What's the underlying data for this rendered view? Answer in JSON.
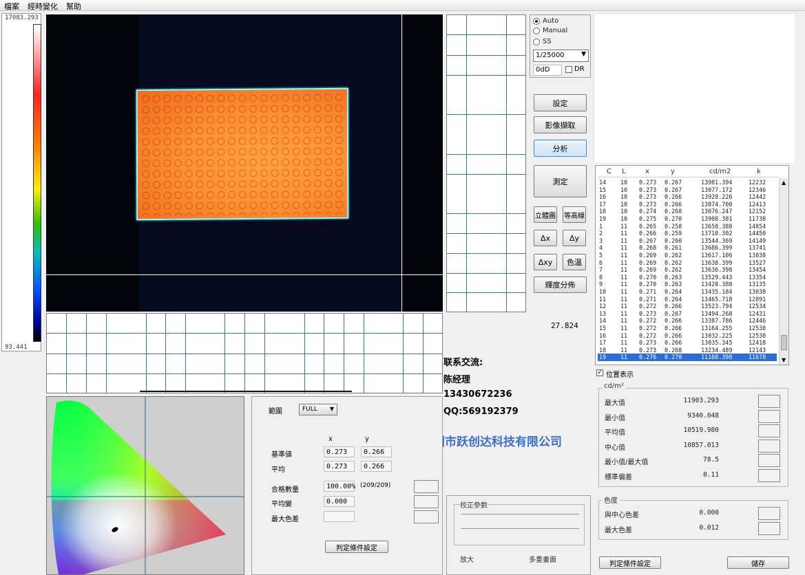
{
  "menu": [
    "檔案",
    "經時變化",
    "幫助"
  ],
  "scale": {
    "max": "17083.293",
    "min": "93.441"
  },
  "camera": {
    "modes": [
      "Auto",
      "Manual",
      "SS"
    ],
    "selected_mode": "Auto",
    "shutter": "1/25000",
    "nd": "0dD",
    "dr_label": "DR"
  },
  "buttons": {
    "settings": "設定",
    "capture": "影像擷取",
    "analyze": "分析",
    "measure": "測定",
    "view3d": "立體圖",
    "contour": "等高線",
    "dx": "Δx",
    "dy": "Δy",
    "dxy": "Δxy",
    "color_temp": "色温",
    "brightness_dist": "輝度分佈",
    "judge_settings": "判定條件設定",
    "judge_settings2": "判定條件設定",
    "save": "儲存"
  },
  "readout": "27.824",
  "contact": {
    "title": "联系交流:",
    "name": "陈经理",
    "phone": "13430672236",
    "qq": "QQ:569192379",
    "company": "深圳市跃创达科技有限公司"
  },
  "range_panel": {
    "range_label": "範圍",
    "range_value": "FULL",
    "col_x": "x",
    "col_y": "y",
    "ref_label": "基準値",
    "ref_x": "0.273",
    "ref_y": "0.266",
    "avg_label": "平均",
    "avg_x": "0.273",
    "avg_y": "0.266",
    "pass_label": "合格數量",
    "pass_value": "100.00%",
    "pass_count": "(209/209)",
    "avg_change_label": "平均變",
    "avg_change_value": "0.000",
    "max_diff_label": "最大色差"
  },
  "calib": {
    "title": "校正參數",
    "zoom": "放大",
    "multi": "多重畫面"
  },
  "table": {
    "headers": [
      "C",
      "L",
      "x",
      "y",
      "cd/m2",
      "k"
    ],
    "rows": [
      [
        "14",
        "10",
        "0.273",
        "0.267",
        "13981.394",
        "12232"
      ],
      [
        "15",
        "10",
        "0.273",
        "0.267",
        "13077.172",
        "12346"
      ],
      [
        "16",
        "10",
        "0.273",
        "0.266",
        "13928.226",
        "12442"
      ],
      [
        "17",
        "10",
        "0.273",
        "0.266",
        "13874.700",
        "12413"
      ],
      [
        "18",
        "10",
        "0.274",
        "0.268",
        "13076.247",
        "12152"
      ],
      [
        "19",
        "10",
        "0.275",
        "0.270",
        "13908.381",
        "11738"
      ],
      [
        "1",
        "11",
        "0.265",
        "0.258",
        "13658.388",
        "14854"
      ],
      [
        "2",
        "11",
        "0.266",
        "0.259",
        "13718.302",
        "14450"
      ],
      [
        "3",
        "11",
        "0.267",
        "0.260",
        "13544.369",
        "14149"
      ],
      [
        "4",
        "11",
        "0.268",
        "0.261",
        "13686.399",
        "13741"
      ],
      [
        "5",
        "11",
        "0.269",
        "0.262",
        "13617.106",
        "13838"
      ],
      [
        "6",
        "11",
        "0.269",
        "0.262",
        "13638.399",
        "13527"
      ],
      [
        "7",
        "11",
        "0.269",
        "0.262",
        "13636.398",
        "13454"
      ],
      [
        "8",
        "11",
        "0.270",
        "0.263",
        "13529.443",
        "13354"
      ],
      [
        "9",
        "11",
        "0.270",
        "0.263",
        "13428.388",
        "13135"
      ],
      [
        "10",
        "11",
        "0.271",
        "0.264",
        "13435.184",
        "13038"
      ],
      [
        "11",
        "11",
        "0.271",
        "0.264",
        "13465.718",
        "12891"
      ],
      [
        "12",
        "11",
        "0.272",
        "0.266",
        "13523.794",
        "12534"
      ],
      [
        "13",
        "11",
        "0.273",
        "0.267",
        "13494.268",
        "12431"
      ],
      [
        "14",
        "11",
        "0.272",
        "0.266",
        "13387.786",
        "12446"
      ],
      [
        "15",
        "11",
        "0.272",
        "0.266",
        "13164.255",
        "12538"
      ],
      [
        "16",
        "11",
        "0.272",
        "0.266",
        "13032.225",
        "12530"
      ],
      [
        "17",
        "11",
        "0.273",
        "0.266",
        "13035.345",
        "12418"
      ],
      [
        "18",
        "11",
        "0.273",
        "0.268",
        "13234.489",
        "12143"
      ],
      [
        "19",
        "11",
        "0.276",
        "0.270",
        "11168.398",
        "11678"
      ]
    ],
    "selected_index": 24
  },
  "position_display": "位置表示",
  "luminance": {
    "title": "cd/m²",
    "items": [
      {
        "label": "最大值",
        "value": "11903.293"
      },
      {
        "label": "最小值",
        "value": "9340.048"
      },
      {
        "label": "平均值",
        "value": "10519.980"
      },
      {
        "label": "中心值",
        "value": "10857.013"
      },
      {
        "label": "最小值/最大值",
        "value": "78.5"
      },
      {
        "label": "標準偏差",
        "value": "0.11"
      }
    ]
  },
  "chroma": {
    "title": "色度",
    "items": [
      {
        "label": "與中心色差",
        "value": "0.000"
      },
      {
        "label": "最大色差",
        "value": "0.012"
      }
    ]
  }
}
